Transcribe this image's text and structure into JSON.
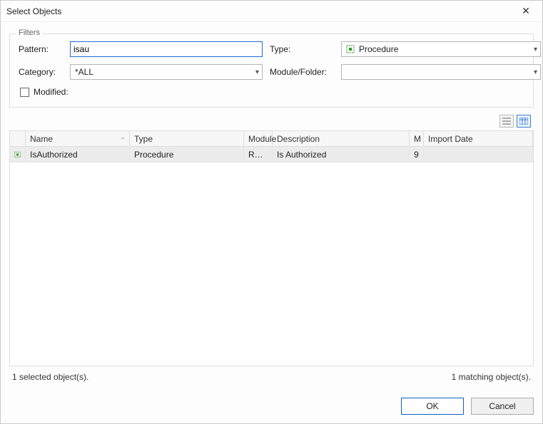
{
  "window": {
    "title": "Select Objects"
  },
  "filters": {
    "legend": "Filters",
    "pattern_label": "Pattern:",
    "pattern_value": "isau",
    "category_label": "Category:",
    "category_value": "*ALL",
    "type_label": "Type:",
    "type_value": "Procedure",
    "modulefolder_label": "Module/Folder:",
    "modulefolder_value": "",
    "modified_label": "Modified:"
  },
  "columns": {
    "name": "Name",
    "type": "Type",
    "module": "Module",
    "description": "Description",
    "m": "M",
    "import_date": "Import Date"
  },
  "rows": [
    {
      "name": "IsAuthorized",
      "type": "Procedure",
      "module": "Root...",
      "description": "Is Authorized",
      "m": "9",
      "import_date": ""
    }
  ],
  "status": {
    "selected": "1 selected object(s).",
    "matching": "1 matching object(s)."
  },
  "buttons": {
    "ok": "OK",
    "cancel": "Cancel"
  }
}
